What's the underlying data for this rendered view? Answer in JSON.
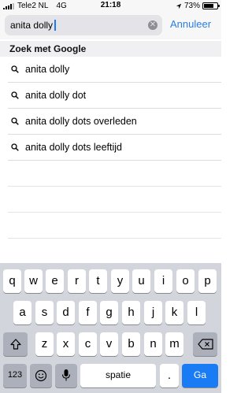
{
  "status_bar": {
    "carrier": "Tele2 NL",
    "network": "4G",
    "time": "21:18",
    "battery_percent": "73%",
    "battery_level": 0.73
  },
  "search": {
    "query": "anita dolly",
    "cancel_label": "Annuleer"
  },
  "section": {
    "header": "Zoek met Google"
  },
  "suggestions": [
    {
      "label": "anita dolly",
      "icon": "search-icon"
    },
    {
      "label": "anita dolly dot",
      "icon": "search-icon"
    },
    {
      "label": "anita dolly dots overleden",
      "icon": "search-icon"
    },
    {
      "label": "anita dolly dots leeftijd",
      "icon": "search-icon"
    }
  ],
  "keyboard": {
    "row1": [
      "q",
      "w",
      "e",
      "r",
      "t",
      "y",
      "u",
      "i",
      "o",
      "p"
    ],
    "row2": [
      "a",
      "s",
      "d",
      "f",
      "g",
      "h",
      "j",
      "k",
      "l"
    ],
    "row3": [
      "z",
      "x",
      "c",
      "v",
      "b",
      "n",
      "m"
    ],
    "numbers_label": "123",
    "space_label": "spatie",
    "period_label": ".",
    "go_label": "Ga",
    "shift_icon": "shift-icon",
    "delete_icon": "backspace-icon",
    "emoji_icon": "emoji-icon",
    "mic_icon": "microphone-icon",
    "go_color": "#1a7cf5"
  }
}
